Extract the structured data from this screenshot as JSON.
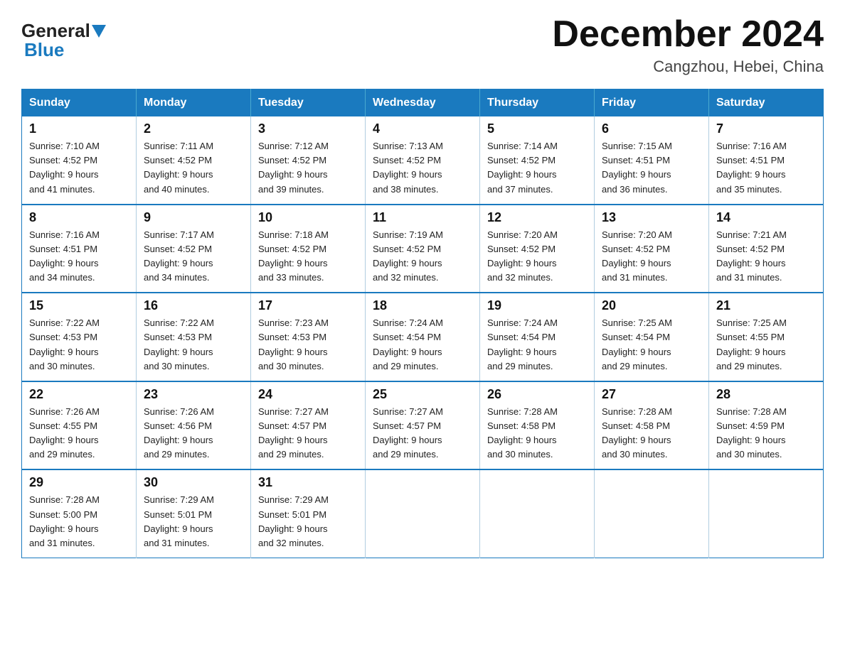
{
  "header": {
    "logo": {
      "general": "General",
      "blue": "Blue"
    },
    "title": "December 2024",
    "location": "Cangzhou, Hebei, China"
  },
  "calendar": {
    "days_of_week": [
      "Sunday",
      "Monday",
      "Tuesday",
      "Wednesday",
      "Thursday",
      "Friday",
      "Saturday"
    ],
    "weeks": [
      [
        {
          "day": "1",
          "sunrise": "7:10 AM",
          "sunset": "4:52 PM",
          "daylight": "9 hours and 41 minutes."
        },
        {
          "day": "2",
          "sunrise": "7:11 AM",
          "sunset": "4:52 PM",
          "daylight": "9 hours and 40 minutes."
        },
        {
          "day": "3",
          "sunrise": "7:12 AM",
          "sunset": "4:52 PM",
          "daylight": "9 hours and 39 minutes."
        },
        {
          "day": "4",
          "sunrise": "7:13 AM",
          "sunset": "4:52 PM",
          "daylight": "9 hours and 38 minutes."
        },
        {
          "day": "5",
          "sunrise": "7:14 AM",
          "sunset": "4:52 PM",
          "daylight": "9 hours and 37 minutes."
        },
        {
          "day": "6",
          "sunrise": "7:15 AM",
          "sunset": "4:51 PM",
          "daylight": "9 hours and 36 minutes."
        },
        {
          "day": "7",
          "sunrise": "7:16 AM",
          "sunset": "4:51 PM",
          "daylight": "9 hours and 35 minutes."
        }
      ],
      [
        {
          "day": "8",
          "sunrise": "7:16 AM",
          "sunset": "4:51 PM",
          "daylight": "9 hours and 34 minutes."
        },
        {
          "day": "9",
          "sunrise": "7:17 AM",
          "sunset": "4:52 PM",
          "daylight": "9 hours and 34 minutes."
        },
        {
          "day": "10",
          "sunrise": "7:18 AM",
          "sunset": "4:52 PM",
          "daylight": "9 hours and 33 minutes."
        },
        {
          "day": "11",
          "sunrise": "7:19 AM",
          "sunset": "4:52 PM",
          "daylight": "9 hours and 32 minutes."
        },
        {
          "day": "12",
          "sunrise": "7:20 AM",
          "sunset": "4:52 PM",
          "daylight": "9 hours and 32 minutes."
        },
        {
          "day": "13",
          "sunrise": "7:20 AM",
          "sunset": "4:52 PM",
          "daylight": "9 hours and 31 minutes."
        },
        {
          "day": "14",
          "sunrise": "7:21 AM",
          "sunset": "4:52 PM",
          "daylight": "9 hours and 31 minutes."
        }
      ],
      [
        {
          "day": "15",
          "sunrise": "7:22 AM",
          "sunset": "4:53 PM",
          "daylight": "9 hours and 30 minutes."
        },
        {
          "day": "16",
          "sunrise": "7:22 AM",
          "sunset": "4:53 PM",
          "daylight": "9 hours and 30 minutes."
        },
        {
          "day": "17",
          "sunrise": "7:23 AM",
          "sunset": "4:53 PM",
          "daylight": "9 hours and 30 minutes."
        },
        {
          "day": "18",
          "sunrise": "7:24 AM",
          "sunset": "4:54 PM",
          "daylight": "9 hours and 29 minutes."
        },
        {
          "day": "19",
          "sunrise": "7:24 AM",
          "sunset": "4:54 PM",
          "daylight": "9 hours and 29 minutes."
        },
        {
          "day": "20",
          "sunrise": "7:25 AM",
          "sunset": "4:54 PM",
          "daylight": "9 hours and 29 minutes."
        },
        {
          "day": "21",
          "sunrise": "7:25 AM",
          "sunset": "4:55 PM",
          "daylight": "9 hours and 29 minutes."
        }
      ],
      [
        {
          "day": "22",
          "sunrise": "7:26 AM",
          "sunset": "4:55 PM",
          "daylight": "9 hours and 29 minutes."
        },
        {
          "day": "23",
          "sunrise": "7:26 AM",
          "sunset": "4:56 PM",
          "daylight": "9 hours and 29 minutes."
        },
        {
          "day": "24",
          "sunrise": "7:27 AM",
          "sunset": "4:57 PM",
          "daylight": "9 hours and 29 minutes."
        },
        {
          "day": "25",
          "sunrise": "7:27 AM",
          "sunset": "4:57 PM",
          "daylight": "9 hours and 29 minutes."
        },
        {
          "day": "26",
          "sunrise": "7:28 AM",
          "sunset": "4:58 PM",
          "daylight": "9 hours and 30 minutes."
        },
        {
          "day": "27",
          "sunrise": "7:28 AM",
          "sunset": "4:58 PM",
          "daylight": "9 hours and 30 minutes."
        },
        {
          "day": "28",
          "sunrise": "7:28 AM",
          "sunset": "4:59 PM",
          "daylight": "9 hours and 30 minutes."
        }
      ],
      [
        {
          "day": "29",
          "sunrise": "7:28 AM",
          "sunset": "5:00 PM",
          "daylight": "9 hours and 31 minutes."
        },
        {
          "day": "30",
          "sunrise": "7:29 AM",
          "sunset": "5:01 PM",
          "daylight": "9 hours and 31 minutes."
        },
        {
          "day": "31",
          "sunrise": "7:29 AM",
          "sunset": "5:01 PM",
          "daylight": "9 hours and 32 minutes."
        },
        null,
        null,
        null,
        null
      ]
    ],
    "labels": {
      "sunrise": "Sunrise:",
      "sunset": "Sunset:",
      "daylight": "Daylight:"
    }
  }
}
